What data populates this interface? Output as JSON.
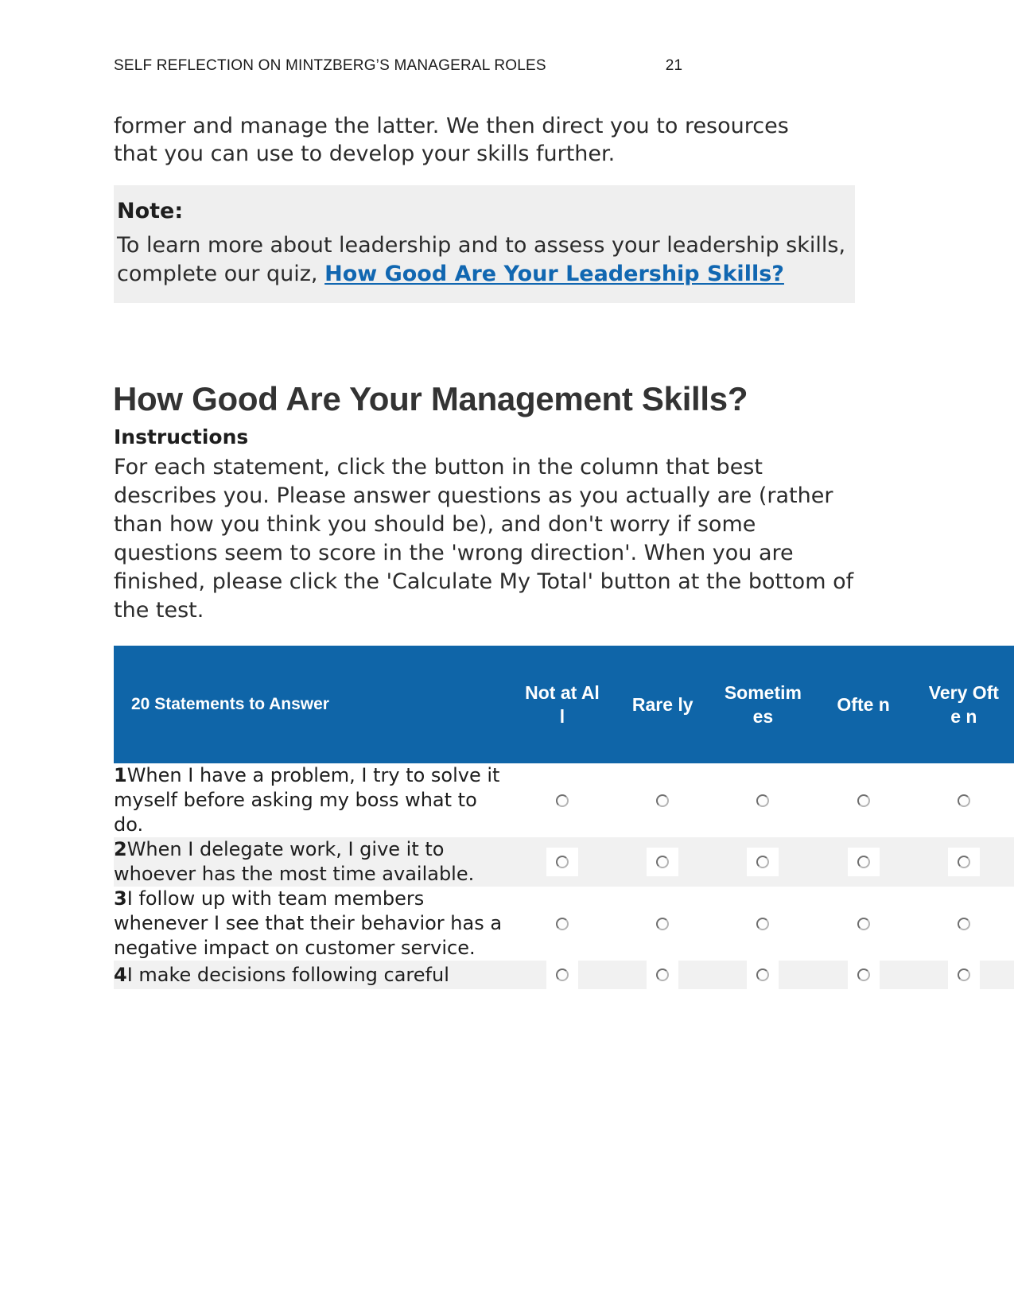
{
  "running_header": {
    "title": "SELF REFLECTION ON MINTZBERG’S MANAGERAL ROLES",
    "page_number": "21"
  },
  "body_paragraph": "former and manage the latter. We then direct you to resources that you can use to develop your skills further.",
  "note": {
    "title": "Note:",
    "text_before_link": "To learn more about leadership and to assess your leadership skills, complete our quiz, ",
    "link_text": "How Good Are Your Leadership Skills?",
    "background_color": "#efefef",
    "link_color": "#1167b1"
  },
  "main_heading": "How Good Are Your Management Skills?",
  "instructions": {
    "title": "Instructions",
    "body": "For each statement, click the button in the column that best describes you. Please answer questions as you actually are (rather than how you think you should be), and don't worry if some questions seem to score in the 'wrong direction'. When you are finished, please click the 'Calculate My Total' button at the bottom of the test."
  },
  "quiz_table": {
    "header_background": "#0f65a8",
    "header_text_color": "#ffffff",
    "alt_row_background": "#f1f1f1",
    "columns": [
      "20 Statements to Answer",
      "Not at All",
      "Rare ly",
      "Sometim es",
      "Ofte n",
      "Very Ofte n"
    ],
    "rows": [
      {
        "number": "1",
        "statement": "When I have a problem, I try to solve it myself before asking my boss what to do.",
        "options": [
          "Not at All",
          "Rarely",
          "Sometimes",
          "Often",
          "Very Often"
        ],
        "selected": null,
        "boxed_inputs": false
      },
      {
        "number": "2",
        "statement": "When I delegate work, I give it to whoever has the most time available.",
        "options": [
          "Not at All",
          "Rarely",
          "Sometimes",
          "Often",
          "Very Often"
        ],
        "selected": null,
        "boxed_inputs": true
      },
      {
        "number": "3",
        "statement": "I follow up with team members whenever I see that their behavior has a negative impact on customer service.",
        "options": [
          "Not at All",
          "Rarely",
          "Sometimes",
          "Often",
          "Very Often"
        ],
        "selected": null,
        "boxed_inputs": false
      },
      {
        "number": "4",
        "statement": "I make decisions following careful",
        "options": [
          "Not at All",
          "Rarely",
          "Sometimes",
          "Often",
          "Very Often"
        ],
        "selected": null,
        "boxed_inputs": true
      }
    ]
  }
}
